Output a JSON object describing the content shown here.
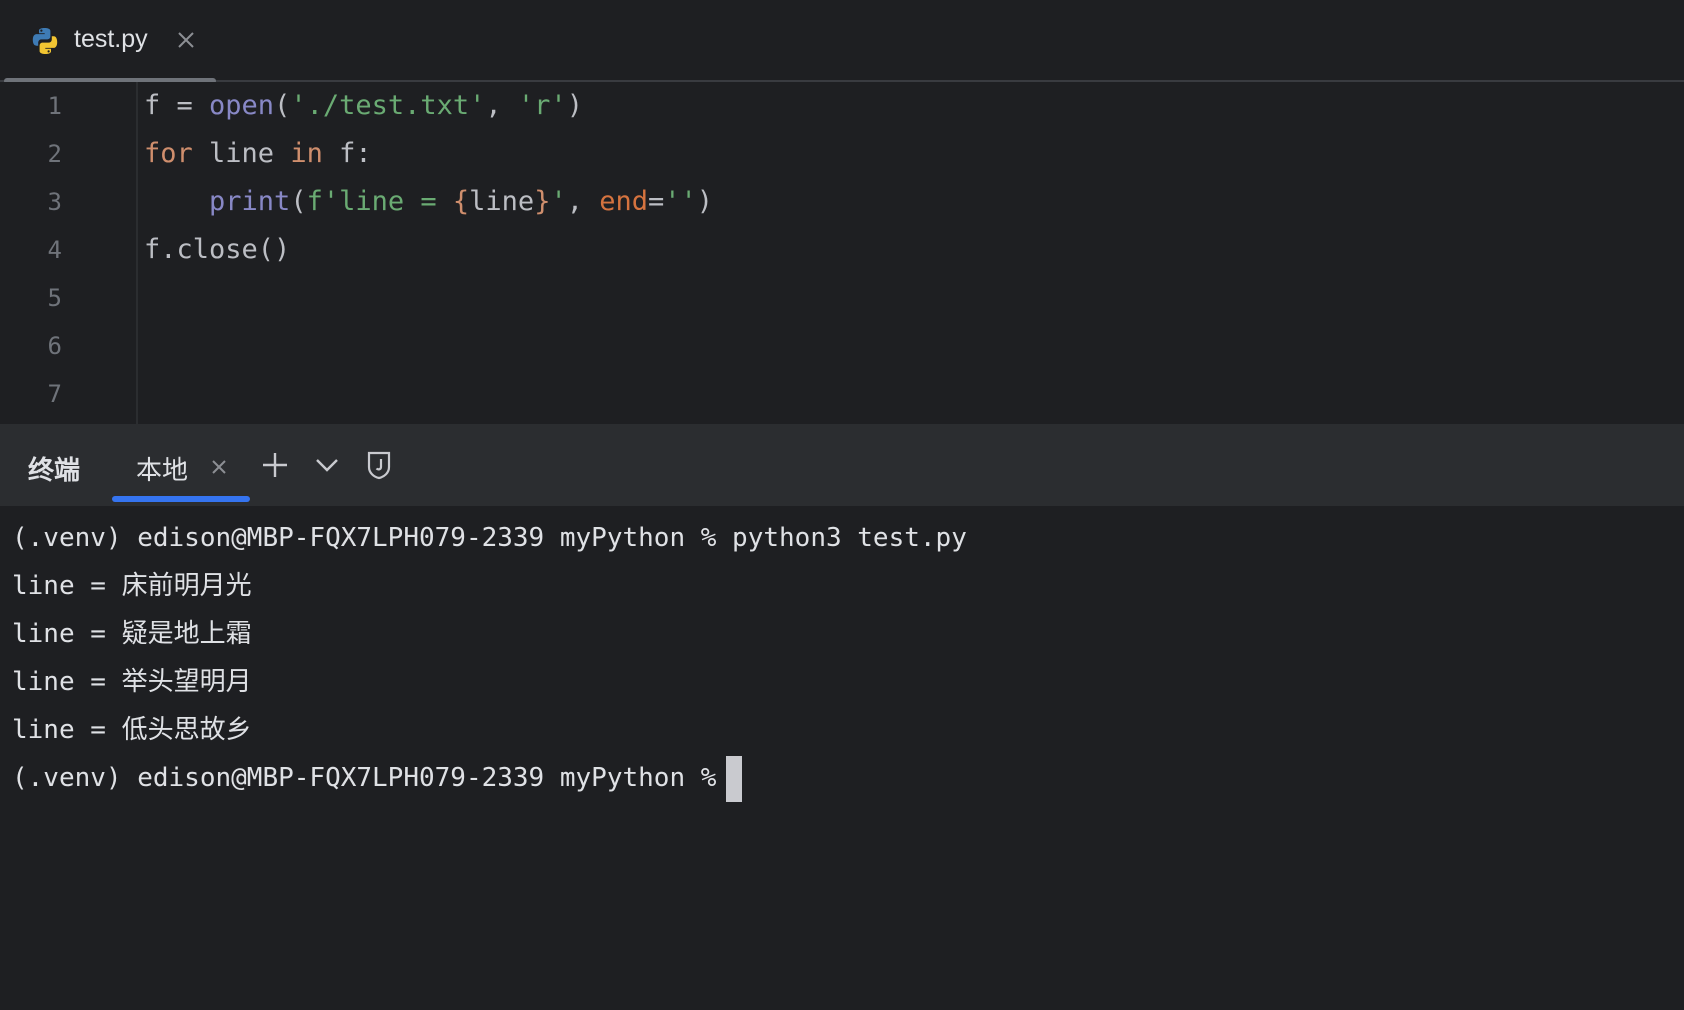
{
  "editor_tab": {
    "filename": "test.py",
    "icon": "python-icon"
  },
  "line_numbers": [
    "1",
    "2",
    "3",
    "4",
    "5",
    "6",
    "7"
  ],
  "code": {
    "line1": {
      "a": "f = ",
      "b": "open",
      "c": "(",
      "d": "'./test.txt'",
      "e": ", ",
      "f": "'r'",
      "g": ")"
    },
    "line2": {
      "a": "for",
      "b": " line ",
      "c": "in",
      "d": " f:"
    },
    "line3": {
      "indent": "    ",
      "a": "print",
      "b": "(",
      "c": "f'line = ",
      "d": "{",
      "e": "line",
      "f": "}",
      "g": "'",
      "h": ", ",
      "i": "end",
      "j": "=",
      "k": "''",
      "l": ")"
    },
    "line4": {
      "a": "f.close()"
    }
  },
  "terminal": {
    "title": "终端",
    "tab_label": "本地",
    "lines": [
      "(.venv) edison@MBP-FQX7LPH079-2339 myPython % python3 test.py",
      "line = 床前明月光",
      "line = 疑是地上霜",
      "line = 举头望明月",
      "line = 低头思故乡",
      "(.venv) edison@MBP-FQX7LPH079-2339 myPython %"
    ]
  },
  "colors": {
    "background": "#1e1f22",
    "accent": "#3574f0",
    "keyword": "#cf8e6d",
    "string": "#6aab73",
    "function": "#8888c6"
  }
}
